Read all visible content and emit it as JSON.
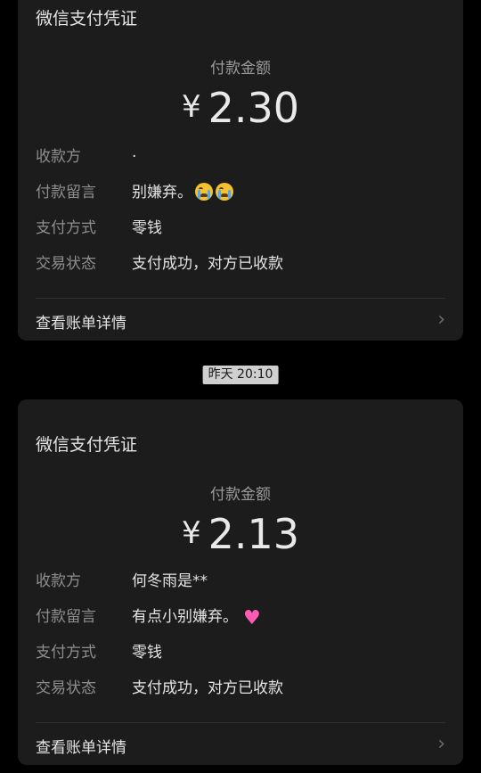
{
  "cards": [
    {
      "title": "微信支付凭证",
      "amount_label": "付款金额",
      "currency_symbol": "¥",
      "amount": "2.30",
      "fields": [
        {
          "key": "收款方",
          "value": "·"
        },
        {
          "key": "付款留言",
          "value": "别嫌弃。",
          "emoji": [
            "crying-face-icon",
            "crying-face-icon"
          ]
        },
        {
          "key": "支付方式",
          "value": "零钱"
        },
        {
          "key": "交易状态",
          "value": "支付成功，对方已收款"
        }
      ],
      "details_label": "查看账单详情"
    },
    {
      "title": "微信支付凭证",
      "amount_label": "付款金额",
      "currency_symbol": "¥",
      "amount": "2.13",
      "fields": [
        {
          "key": "收款方",
          "value": "何冬雨是**"
        },
        {
          "key": "付款留言",
          "value": "有点小别嫌弃。",
          "emoji": [
            "pink-heart-icon"
          ]
        },
        {
          "key": "支付方式",
          "value": "零钱"
        },
        {
          "key": "交易状态",
          "value": "支付成功，对方已收款"
        }
      ],
      "details_label": "查看账单详情"
    }
  ],
  "timestamp": "昨天 20:10",
  "colors": {
    "background": "#000000",
    "card": "#1c1c1c",
    "secondary_text": "#8e8e8e",
    "timestamp_bg": "#cfcfcf"
  }
}
